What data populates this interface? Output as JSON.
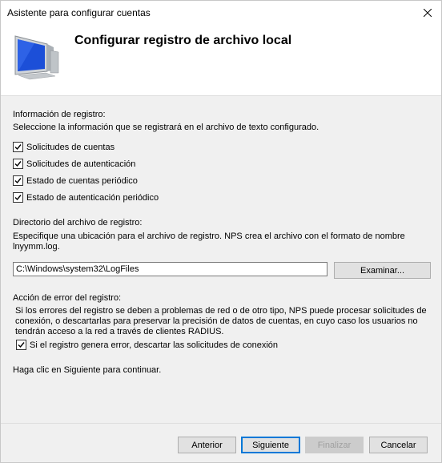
{
  "window": {
    "title": "Asistente para configurar cuentas",
    "close_glyph": "✕"
  },
  "header": {
    "title": "Configurar registro de archivo local",
    "icon": "computer-monitor-icon"
  },
  "log_info": {
    "heading": "Información de registro:",
    "description": "Seleccione la información que se registrará en el archivo de texto configurado.",
    "options": [
      {
        "label": "Solicitudes de cuentas",
        "checked": true
      },
      {
        "label": "Solicitudes de autenticación",
        "checked": true
      },
      {
        "label": "Estado de cuentas periódico",
        "checked": true
      },
      {
        "label": "Estado de autenticación periódico",
        "checked": true
      }
    ]
  },
  "directory": {
    "heading": "Directorio del archivo de registro:",
    "description_line1": "Especifique una ubicación para el archivo de registro. NPS crea el archivo con el formato de nombre",
    "description_line2": "lnyymm.log.",
    "path_value": "C:\\Windows\\system32\\LogFiles",
    "browse_label": "Examinar..."
  },
  "error_action": {
    "heading": "Acción de error del registro:",
    "description_line1": "Si los errores del registro se deben a problemas de red o de otro tipo, NPS puede procesar solicitudes de",
    "description_line2": "conexión, o descartarlas para preservar la precisión de datos de cuentas, en cuyo caso los usuarios no",
    "description_line3": "tendrán acceso a la red a través de clientes RADIUS.",
    "discard_label": "Si el registro genera error, descartar las solicitudes de conexión",
    "discard_checked": true
  },
  "continue_text": "Haga clic en Siguiente para continuar.",
  "buttons": {
    "back": "Anterior",
    "next": "Siguiente",
    "finish": "Finalizar",
    "cancel": "Cancelar"
  },
  "colors": {
    "accent": "#0078d7",
    "window_bg": "#f0f0f0",
    "header_bg": "#ffffff"
  }
}
